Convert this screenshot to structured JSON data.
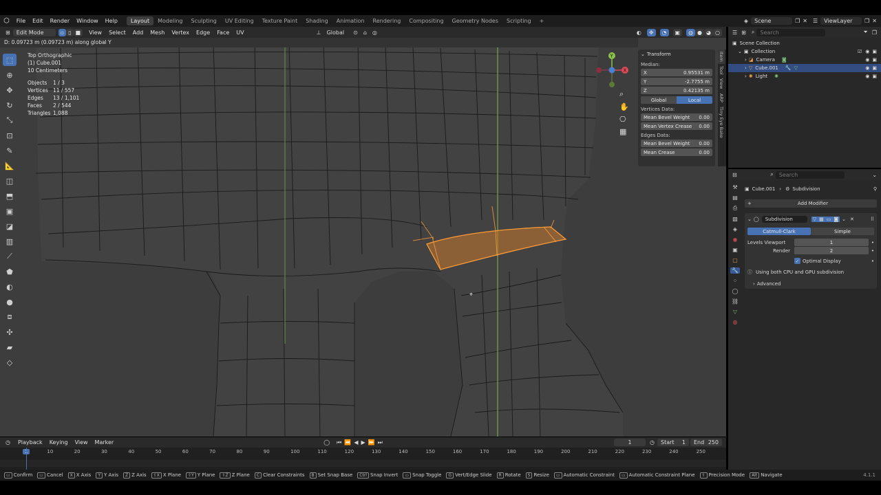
{
  "menubar": {
    "items": [
      "File",
      "Edit",
      "Render",
      "Window",
      "Help"
    ],
    "workspaces": [
      "Layout",
      "Modeling",
      "Sculpting",
      "UV Editing",
      "Texture Paint",
      "Shading",
      "Animation",
      "Rendering",
      "Compositing",
      "Geometry Nodes",
      "Scripting"
    ],
    "add_tab": "+",
    "scene": "Scene",
    "view_layer": "ViewLayer"
  },
  "viewport_header": {
    "mode": "Edit Mode",
    "menus": [
      "View",
      "Select",
      "Add",
      "Mesh",
      "Vertex",
      "Edge",
      "Face",
      "UV"
    ],
    "orientation": "Global"
  },
  "operator_status": "D: 0.09723 m (0.09723 m) along global Y",
  "overlay_info": {
    "view": "Top Orthographic",
    "object": "(1) Cube.001",
    "scale": "10 Centimeters",
    "stats": [
      {
        "label": "Objects",
        "value": "1 / 3"
      },
      {
        "label": "Vertices",
        "value": "11 / 557"
      },
      {
        "label": "Edges",
        "value": "13 / 1,101"
      },
      {
        "label": "Faces",
        "value": "2 / 544"
      },
      {
        "label": "Triangles",
        "value": "1,088"
      }
    ]
  },
  "transform_panel": {
    "title": "Transform",
    "median_label": "Median:",
    "x_label": "X",
    "x": "0.95531 m",
    "y_label": "Y",
    "y": "-2.7755 m",
    "z_label": "Z",
    "z": "0.42135 m",
    "global": "Global",
    "local": "Local",
    "vertices_data": "Vertices Data:",
    "mean_bevel_weight_label": "Mean Bevel Weight",
    "mean_bevel_weight": "0.00",
    "mean_vertex_crease_label": "Mean Vertex Crease",
    "mean_vertex_crease": "0.00",
    "edges_data": "Edges Data:",
    "edge_bevel_weight_label": "Mean Bevel Weight",
    "edge_bevel_weight": "0.00",
    "mean_crease_label": "Mean Crease",
    "mean_crease": "0.00"
  },
  "side_tabs": [
    "Item",
    "Tool",
    "View",
    "ARP",
    "Tiny Eye Bake"
  ],
  "outliner": {
    "search": "Search",
    "rows": [
      {
        "label": "Scene Collection"
      },
      {
        "label": "Collection"
      },
      {
        "label": "Camera"
      },
      {
        "label": "Cube.001"
      },
      {
        "label": "Light"
      }
    ]
  },
  "properties": {
    "search": "Search",
    "object": "Cube.001",
    "modifier_crumb": "Subdivision",
    "add_modifier": "Add Modifier",
    "modifier_name": "Subdivision",
    "catmull": "Catmull-Clark",
    "simple": "Simple",
    "levels_viewport_label": "Levels Viewport",
    "levels_viewport": "1",
    "render_label": "Render",
    "render": "2",
    "optimal_display": "Optimal Display",
    "info": "Using both CPU and GPU subdivision",
    "advanced": "Advanced"
  },
  "timeline": {
    "menus": [
      "Playback",
      "Keying",
      "View",
      "Marker"
    ],
    "current_frame": "1",
    "start_label": "Start",
    "start": "1",
    "end_label": "End",
    "end": "250",
    "ticks": [
      "1",
      "10",
      "20",
      "30",
      "40",
      "50",
      "60",
      "70",
      "80",
      "90",
      "100",
      "110",
      "120",
      "130",
      "140",
      "150",
      "160",
      "170",
      "180",
      "190",
      "200",
      "210",
      "220",
      "230",
      "240",
      "250"
    ]
  },
  "statusbar": {
    "items": [
      {
        "key": "",
        "label": "Confirm"
      },
      {
        "key": "",
        "label": "Cancel"
      },
      {
        "key": "X",
        "label": "X Axis"
      },
      {
        "key": "Y",
        "label": "Y Axis"
      },
      {
        "key": "Z",
        "label": "Z Axis"
      },
      {
        "key": "⇧X",
        "label": "X Plane"
      },
      {
        "key": "⇧Y",
        "label": "Y Plane"
      },
      {
        "key": "⇧Z",
        "label": "Z Plane"
      },
      {
        "key": "C",
        "label": "Clear Constraints"
      },
      {
        "key": "B",
        "label": "Set Snap Base"
      },
      {
        "key": "Ctrl",
        "label": "Snap Invert"
      },
      {
        "key": "",
        "label": "Snap Toggle"
      },
      {
        "key": "G",
        "label": "Vert/Edge Slide"
      },
      {
        "key": "R",
        "label": "Rotate"
      },
      {
        "key": "S",
        "label": "Resize"
      },
      {
        "key": "",
        "label": "Automatic Constraint"
      },
      {
        "key": "",
        "label": "Automatic Constraint Plane"
      },
      {
        "key": "⇧",
        "label": "Precision Mode"
      },
      {
        "key": "Alt",
        "label": "Navigate"
      }
    ],
    "version": "4.1.1"
  }
}
